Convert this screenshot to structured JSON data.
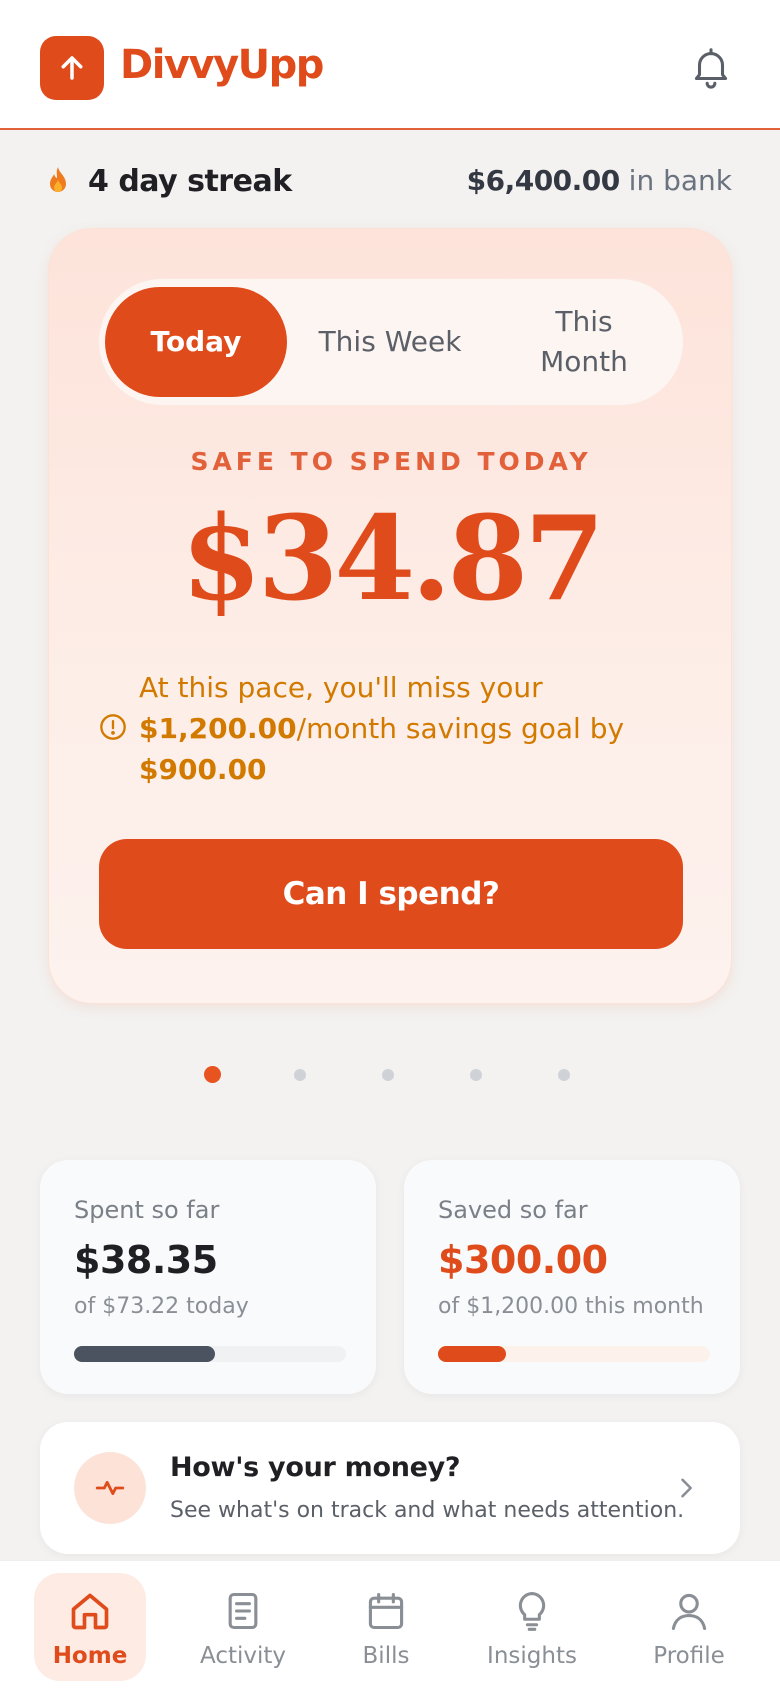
{
  "app": {
    "brand": "DivvyUpp"
  },
  "header": {
    "logo_icon": "arrow-up-icon",
    "notifications_icon": "bell-icon"
  },
  "summary": {
    "streak": "4 day streak",
    "bank_amount": "$6,400.00",
    "bank_suffix": "in bank"
  },
  "period_tabs": [
    {
      "label": "Today",
      "active": true
    },
    {
      "label": "This Week",
      "active": false
    },
    {
      "label": "This Month",
      "active": false
    }
  ],
  "safe_to_spend": {
    "label": "SAFE TO SPEND TODAY",
    "amount": "$34.87"
  },
  "warning": {
    "text_before": "At this pace, you'll miss your ",
    "goal_amount": "$1,200.00",
    "text_middle": "/month savings goal by ",
    "shortfall": "$900.00"
  },
  "cta": {
    "label": "Can I spend?"
  },
  "carousel": {
    "page_count": 5,
    "active_index": 0
  },
  "spent": {
    "label": "Spent so far",
    "value": "$38.35",
    "sub": "of $73.22 today",
    "progress": 0.52
  },
  "saved": {
    "label": "Saved so far",
    "value": "$300.00",
    "sub": "of $1,200.00 this month",
    "progress": 0.25
  },
  "health": {
    "title": "How's your money?",
    "subtitle": "See what's on track and what needs attention."
  },
  "nav": [
    {
      "label": "Home",
      "icon": "home-icon",
      "active": true
    },
    {
      "label": "Activity",
      "icon": "document-icon",
      "active": false
    },
    {
      "label": "Bills",
      "icon": "calendar-icon",
      "active": false
    },
    {
      "label": "Insights",
      "icon": "lightbulb-icon",
      "active": false
    },
    {
      "label": "Profile",
      "icon": "user-icon",
      "active": false
    }
  ],
  "colors": {
    "accent": "#e04b1c",
    "warning": "#d27a00",
    "spent_bar": "#4b5260"
  }
}
